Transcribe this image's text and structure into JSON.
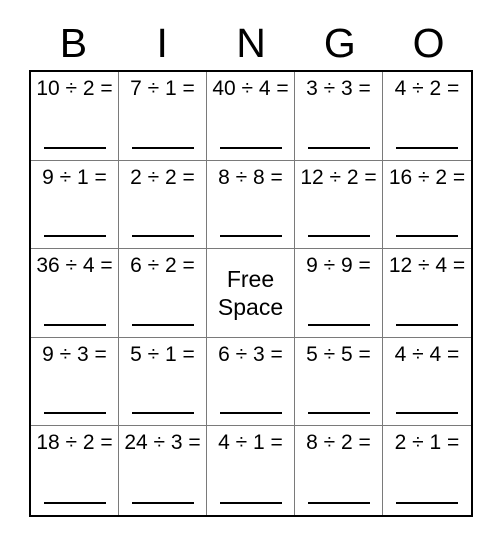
{
  "card": {
    "title_letters": [
      "B",
      "I",
      "N",
      "G",
      "O"
    ],
    "free_space_label_line1": "Free",
    "free_space_label_line2": "Space",
    "accent_color": "#000000",
    "grid_line_color": "#7a7a7a",
    "background_color": "#ffffff",
    "rows": [
      [
        {
          "text": "10 ÷ 2 =",
          "free": false
        },
        {
          "text": "7 ÷ 1 =",
          "free": false
        },
        {
          "text": "40 ÷ 4 =",
          "free": false
        },
        {
          "text": "3 ÷ 3 =",
          "free": false
        },
        {
          "text": "4 ÷ 2 =",
          "free": false
        }
      ],
      [
        {
          "text": "9 ÷ 1 =",
          "free": false
        },
        {
          "text": "2 ÷ 2 =",
          "free": false
        },
        {
          "text": "8 ÷ 8 =",
          "free": false
        },
        {
          "text": "12 ÷ 2 =",
          "free": false
        },
        {
          "text": "16 ÷ 2 =",
          "free": false
        }
      ],
      [
        {
          "text": "36 ÷ 4 =",
          "free": false
        },
        {
          "text": "6 ÷ 2 =",
          "free": false
        },
        {
          "text": "Free Space",
          "free": true
        },
        {
          "text": "9 ÷ 9 =",
          "free": false
        },
        {
          "text": "12 ÷ 4 =",
          "free": false
        }
      ],
      [
        {
          "text": "9 ÷ 3 =",
          "free": false
        },
        {
          "text": "5 ÷ 1 =",
          "free": false
        },
        {
          "text": "6 ÷ 3 =",
          "free": false
        },
        {
          "text": "5 ÷ 5 =",
          "free": false
        },
        {
          "text": "4 ÷ 4 =",
          "free": false
        }
      ],
      [
        {
          "text": "18 ÷ 2 =",
          "free": false
        },
        {
          "text": "24 ÷ 3 =",
          "free": false
        },
        {
          "text": "4 ÷ 1 =",
          "free": false
        },
        {
          "text": "8 ÷ 2 =",
          "free": false
        },
        {
          "text": "2 ÷ 1 =",
          "free": false
        }
      ]
    ]
  }
}
